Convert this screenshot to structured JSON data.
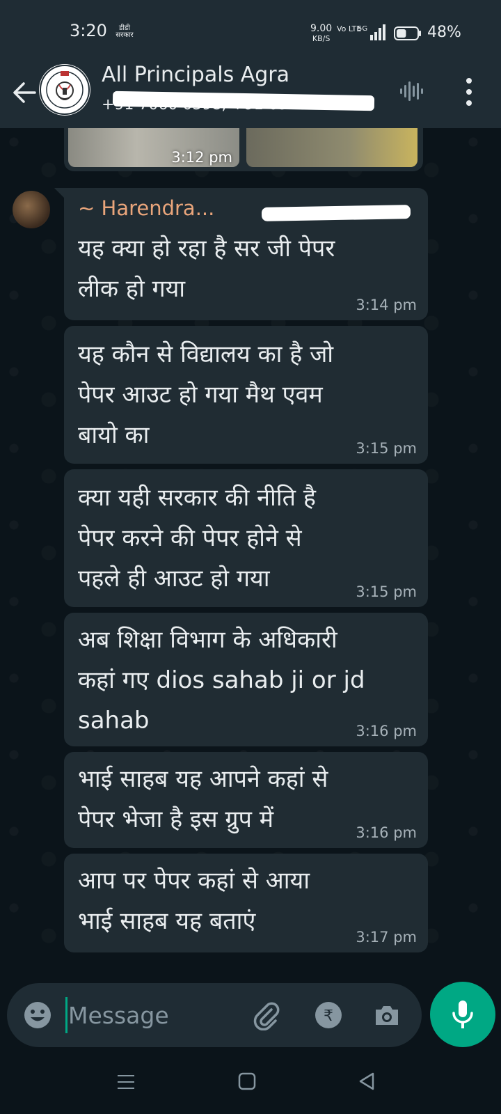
{
  "status_bar": {
    "time": "3:20",
    "carrier_label": "डीडी सरकार",
    "net_speed_value": "9.00",
    "net_speed_unit": "KB/S",
    "volte_label": "Vo LTE",
    "network_type": "5G",
    "battery_percent": "48%",
    "battery_level": 0.48
  },
  "header": {
    "group_name": "All Principals Agra",
    "participants": "+91 7060 0598, +91 0578 8 ..."
  },
  "chat": {
    "image_message": {
      "time": "3:12 pm"
    },
    "sender": {
      "name": "~ Harendra..."
    },
    "messages": [
      {
        "text_lines": [
          "यह क्या हो रहा है सर जी पेपर",
          "लीक हो गया"
        ],
        "time": "3:14 pm"
      },
      {
        "text_lines": [
          "यह कौन से विद्यालय का है जो",
          "पेपर आउट हो गया मैथ एवम",
          "बायो का"
        ],
        "time": "3:15 pm"
      },
      {
        "text_lines": [
          "क्या यही सरकार की नीति है",
          "पेपर करने की पेपर होने से",
          "पहले ही आउट हो गया"
        ],
        "time": "3:15 pm"
      },
      {
        "text_lines": [
          "अब शिक्षा विभाग के अधिकारी",
          "कहां गए dios sahab ji or jd",
          "sahab"
        ],
        "time": "3:16 pm"
      },
      {
        "text_lines": [
          "भाई साहब यह आपने कहां से",
          "पेपर भेजा है इस ग्रुप में"
        ],
        "time": "3:16 pm"
      },
      {
        "text_lines": [
          "आप पर पेपर कहां से आया",
          "भाई साहब यह बताएं"
        ],
        "time": "3:17 pm"
      }
    ]
  },
  "composer": {
    "placeholder": "Message",
    "value": ""
  },
  "icons": {
    "back": "arrow-left-icon",
    "voice_call": "waveform-icon",
    "more": "more-vert-icon",
    "emoji": "emoji-icon",
    "attach": "paperclip-icon",
    "payment": "rupee-icon",
    "camera": "camera-icon",
    "mic": "mic-icon"
  },
  "colors": {
    "accent": "#00a884",
    "sender_name": "#e9a57b",
    "bubble": "#202c33",
    "header": "#1f2c34",
    "background": "#0b141a"
  }
}
